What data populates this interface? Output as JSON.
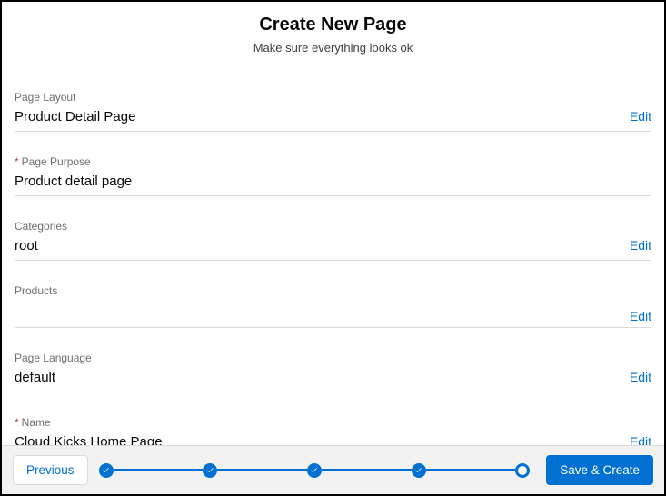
{
  "header": {
    "title": "Create New Page",
    "subtitle": "Make sure everything looks ok"
  },
  "fields": [
    {
      "label": "Page Layout",
      "required": false,
      "value": "Product Detail Page",
      "edit": "Edit"
    },
    {
      "label": "Page Purpose",
      "required": true,
      "value": "Product detail page",
      "edit": ""
    },
    {
      "label": "Categories",
      "required": false,
      "value": "root",
      "edit": "Edit"
    },
    {
      "label": "Products",
      "required": false,
      "value": "",
      "edit": "Edit"
    },
    {
      "label": "Page Language",
      "required": false,
      "value": "default",
      "edit": "Edit"
    },
    {
      "label": "Name",
      "required": true,
      "value": "Cloud Kicks Home Page",
      "edit": "Edit"
    }
  ],
  "footer": {
    "previous": "Previous",
    "save": "Save & Create"
  }
}
